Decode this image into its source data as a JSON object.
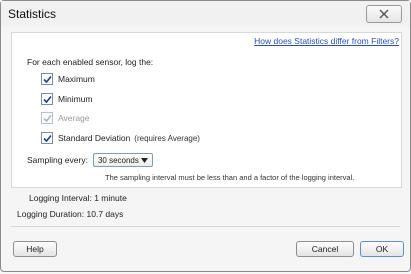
{
  "window": {
    "title": "Statistics"
  },
  "header": {
    "help_link": "How does Statistics differ from Filters?"
  },
  "form": {
    "intro": "For each enabled sensor, log the:",
    "checkboxes": [
      {
        "label": "Maximum",
        "checked": true,
        "disabled": false
      },
      {
        "label": "Minimum",
        "checked": true,
        "disabled": false
      },
      {
        "label": "Average",
        "checked": true,
        "disabled": true
      },
      {
        "label": "Standard Deviation",
        "note": "(requires Average)",
        "checked": true,
        "disabled": false
      }
    ],
    "sampling_label": "Sampling every:",
    "sampling_value": "30 seconds",
    "hint": "The sampling interval must be less than and a factor of the logging interval."
  },
  "info": {
    "logging_interval": "Logging Interval: 1 minute",
    "logging_duration": "Logging Duration: 10.7 days"
  },
  "buttons": {
    "help": "Help",
    "cancel": "Cancel",
    "ok": "OK"
  },
  "colors": {
    "link": "#2a50b4",
    "checkmark": "#1f3f86"
  },
  "icons": {
    "close": "close-icon",
    "check": "checkmark-icon",
    "dropdown": "chevron-down-icon"
  }
}
